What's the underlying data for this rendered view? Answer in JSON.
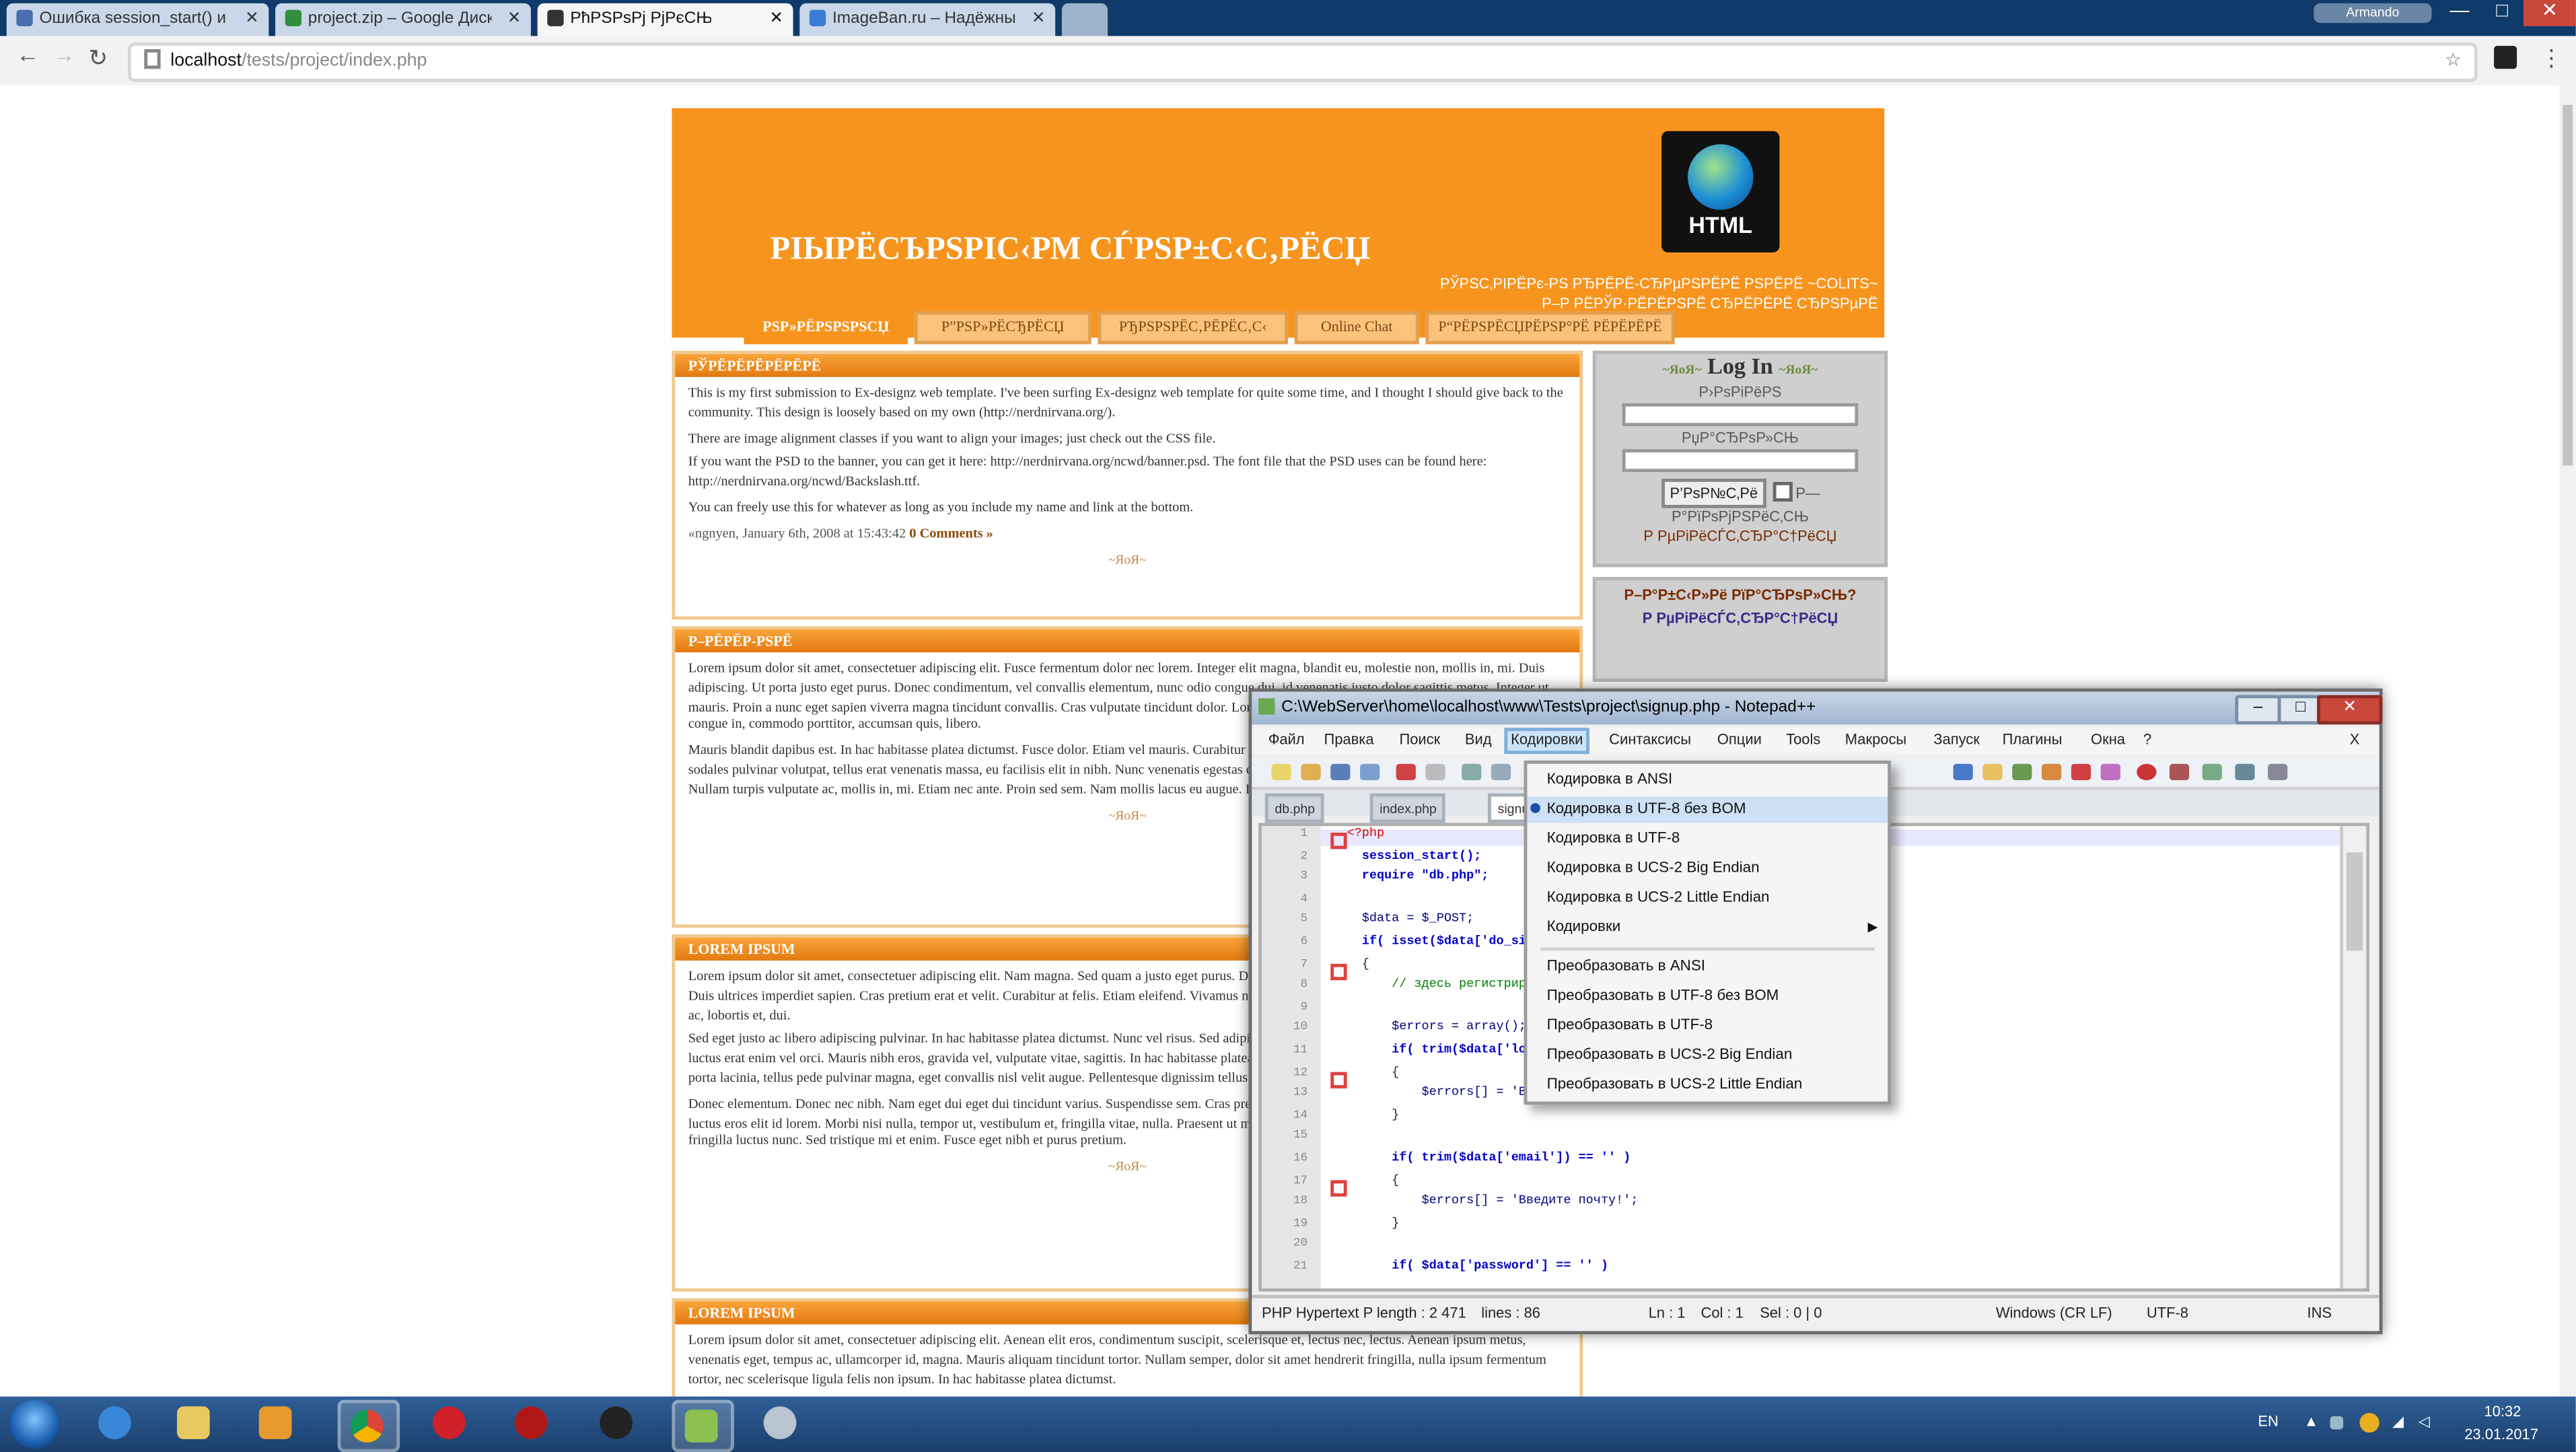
{
  "browser": {
    "tabs": [
      {
        "title": "Ошибка session_start() и ...",
        "fav": "#4a6fb0"
      },
      {
        "title": "project.zip – Google Диск",
        "fav": "#2f8f3f"
      },
      {
        "title": "РћРЅРѕРј РјРєСЊ",
        "fav": "#333333"
      },
      {
        "title": "ImageBan.ru – Надёжный ...",
        "fav": "#3a7bd5"
      }
    ],
    "user": "Armando",
    "url_host": "localhost",
    "url_path": "/tests/project/index.php",
    "minimize": "—",
    "maximize": "□",
    "close": "✕"
  },
  "site": {
    "title": "РІЫРЁСЪРЅРІС‹РМ СЃРЅР±С‹С‚РЁСЏ",
    "logo_label": "HTML",
    "slogan": "РЎРЅС‚РІРЁРє-РЅ РЂРЁРЁ-СЂРµРЅРЁРЁ РЅРЁРЁ ~COLITS~ Р–Р РЁРЎР·РЁРЁРЅРЁ СЂРЁРЁРЁ СЂРЅРµРЁ",
    "menu": [
      "РЅР»РЁРЅРЅРЅСЏ",
      "Р”РЅР»РЁСЂРЁСЏ",
      "РЂРЅРЅРЁС‚РЁРЁС‚С‹",
      "Online Chat",
      "Р“РЁРЅРЁСЏРЁРЅР°РЁ РЁРЁРЁРЁ"
    ],
    "posts": [
      {
        "head": "РЎРЁРЁРЁРЁРЁРЁ",
        "paras": [
          "This is my first submission to Ex-designz web template. I've been surfing Ex-designz web template for quite some time, and I thought I should give back to the community. This design is loosely based on my own (http://nerdnirvana.org/).",
          "There are image alignment classes if you want to align your images; just check out the CSS file.",
          "If you want the PSD to the banner, you can get it here: http://nerdnirvana.org/ncwd/banner.psd. The font file that the PSD uses can be found here: http://nerdnirvana.org/ncwd/Backslash.ttf.",
          "You can freely use this for whatever as long as you include my name and link at the bottom."
        ],
        "meta": "«ngnyen, January 6th, 2008 at 15:43:42",
        "comments": "0 Comments »"
      },
      {
        "head": "Р–РЁРЁР-РЅРЁ",
        "paras": [
          "Lorem ipsum dolor sit amet, consectetuer adipiscing elit. Fusce fermentum dolor nec lorem. Integer elit magna, blandit eu, molestie non, mollis in, mi. Duis adipiscing. Ut porta justo eget purus. Donec condimentum, vel convallis elementum, nunc odio congue dui, id venenatis justo dolor sagittis metus. Integer ut mauris. Proin a nunc eget sapien viverra magna tincidunt convallis. Cras vulputate tincidunt dolor. Lorem ipsum dolor sit amet. Cras eget nunc. Nulla ligula est, congue in, commodo porttitor, accumsan quis, libero.",
          "Mauris blandit dapibus est. In hac habitasse platea dictumst. Fusce dolor. Etiam vel mauris. Curabitur tempus. Curabitur rutrum. Aliquam pellentesque, enim sodales pulvinar volutpat, tellus erat venenatis massa, eu facilisis elit in nibh. Nunc venenatis egestas eros. Praesent vitae dolor placerat lacus auctor ultrices. Nullam turpis vulputate ac, mollis in, mi. Etiam nec ante. Proin sed sem. Nam mollis lacus eu augue. Integer commodo varius elit."
        ]
      },
      {
        "head": "LOREM IPSUM",
        "paras": [
          "Lorem ipsum dolor sit amet, consectetuer adipiscing elit. Nam magna. Sed quam a justo eget purus. Donec accumsan quis libero. Nam pulvinar. Sed id libero. Duis ultrices imperdiet sapien. Cras pretium erat et velit. Curabitur at felis. Etiam eleifend. Vivamus nunc. Vestibulum et felis. Proin justo mi, laoreet eu, mattis ac, lobortis et, dui.",
          "Sed eget justo ac libero adipiscing pulvinar. In hac habitasse platea dictumst. Nunc vel risus. Sed adipiscing. Proin massa risus, iaculis justo mattis mauris, in luctus erat enim vel orci. Mauris nibh eros, gravida vel, vulputate vitae, sagittis. In hac habitasse platea dictumst. Sed sit amet metus. Nam bibendum, felis non porta lacinia, tellus pede pulvinar magna, eget convallis nisl velit augue. Pellentesque dignissim tellus viverra ipsum. Maecenas elementum arcu id ante.",
          "Donec elementum. Donec nec nibh. Nam eget dui eget dui tincidunt varius. Suspendisse sem. Cras pretium pharetra arcu. Nulla massa posuere augue, vitae luctus eros elit id lorem. Morbi nisi nulla, tempor ut, vestibulum et, fringilla vitae, nulla. Praesent ut massa. Mauris bibendum magna vel ante. Suspendisse fringilla luctus nunc. Sed tristique mi et enim. Fusce eget nibh et purus pretium."
        ]
      },
      {
        "head": "LOREM IPSUM",
        "paras": [
          "Lorem ipsum dolor sit amet, consectetuer adipiscing elit. Aenean elit eros, condimentum suscipit, scelerisque et, lectus nec, lectus. Aenean ipsum metus, venenatis eget, tempus ac, ullamcorper id, magna. Mauris aliquam tincidunt tortor. Nullam semper, dolor sit amet hendrerit fringilla, nulla ipsum fermentum tortor, nec scelerisque ligula felis non ipsum. In hac habitasse platea dictumst."
        ]
      }
    ],
    "separator": "~ЯоЯ~",
    "login": {
      "head": "Log In",
      "ornament": "~ЯоЯ~",
      "user_label": "Р›РѕРіРёРЅ",
      "pass_label": "РџР°СЂРѕР»СЊ",
      "submit": "Р’РѕР№С‚Рё",
      "remember": "Р—Р°РїРѕРјРЅРёС‚СЊ",
      "reg_link": "Р РµРіРёСЃС‚СЂР°С†РёСЏ"
    },
    "box2": {
      "line1": "Р–Р°Р±С‹Р»Рё РїР°СЂРѕР»СЊ?",
      "line2": "Р РµРіРёСЃС‚СЂР°С†РёСЏ"
    }
  },
  "npp": {
    "title": "C:\\WebServer\\home\\localhost\\www\\Tests\\project\\signup.php - Notepad++",
    "menu": [
      "Файл",
      "Правка",
      "Поиск",
      "Вид",
      "Кодировки",
      "Синтаксисы",
      "Опции",
      "Tools",
      "Макросы",
      "Запуск",
      "Плагины",
      "Окна",
      "?"
    ],
    "menu_close": "X",
    "filetabs": [
      "db.php",
      "index.php",
      "signup.php"
    ],
    "line_numbers": [
      "1",
      "2",
      "3",
      "4",
      "5",
      "6",
      "7",
      "8",
      "9",
      "10",
      "11",
      "12",
      "13",
      "14",
      "15",
      "16",
      "17",
      "18",
      "19",
      "20",
      "21"
    ],
    "code": [
      "<?php",
      "  session_start();",
      "  require \"db.php\";",
      "",
      "  $data = $_POST;",
      "  if( isset($data['do_signup']) )",
      "  {",
      "      // здесь регистрируем",
      "",
      "      $errors = array();",
      "      if( trim($data['login']) == '' )",
      "      {",
      "          $errors[] = 'Введите логин!';",
      "      }",
      "",
      "      if( trim($data['email']) == '' )",
      "      {",
      "          $errors[] = 'Введите почту!';",
      "      }",
      "",
      "      if( $data['password'] == '' )"
    ],
    "status": {
      "type": "PHP Hypertext P length : 2 471",
      "lines": "lines : 86",
      "pos": "Ln : 1",
      "col": "Col : 1",
      "sel": "Sel : 0 | 0",
      "eol": "Windows (CR LF)",
      "enc": "UTF-8",
      "mode": "INS"
    },
    "encoding_menu": [
      "Кодировка в ANSI",
      "Кодировка в UTF-8 без BOM",
      "Кодировка в UTF-8",
      "Кодировка в UCS-2 Big Endian",
      "Кодировка в UCS-2 Little Endian",
      "Кодировки",
      "Преобразовать в ANSI",
      "Преобразовать в UTF-8 без BOM",
      "Преобразовать в UTF-8",
      "Преобразовать в UCS-2 Big Endian",
      "Преобразовать в UCS-2 Little Endian"
    ]
  },
  "taskbar": {
    "lang": "EN",
    "time": "10:32",
    "date": "23.01.2017"
  },
  "colors": {
    "accent_orange": "#f7941d",
    "titlebar": "#0f3a6a",
    "taskbar": "#1b3f6c"
  }
}
